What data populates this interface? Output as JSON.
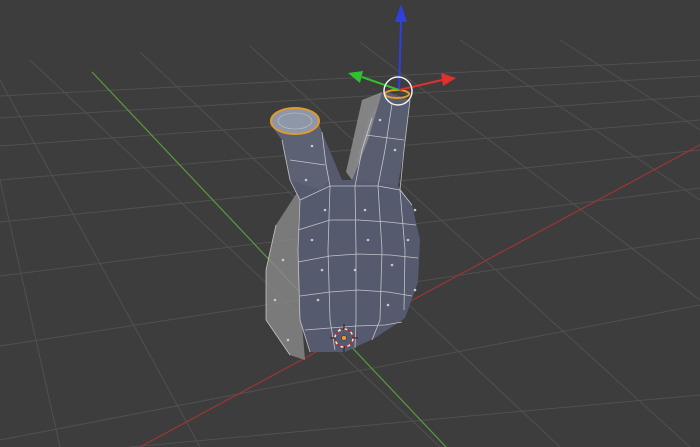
{
  "viewport": {
    "mode": "edit",
    "colors": {
      "background": "#3d3d3d",
      "grid": "#4f4f4f",
      "x_axis": "#9c3535",
      "y_axis": "#5a9a3a",
      "mesh_face": "#555a6e",
      "mesh_face_selected": "#8a8a8a",
      "wire": "#d8d8d8",
      "selected_face": "#e09a2e",
      "gizmo_x": "#e03030",
      "gizmo_y": "#30c030",
      "gizmo_z": "#2f3fe0"
    },
    "icons": {
      "transform_gizmo": "move-arrows-icon",
      "cursor": "3d-cursor-icon",
      "origin": "object-origin-icon"
    }
  }
}
